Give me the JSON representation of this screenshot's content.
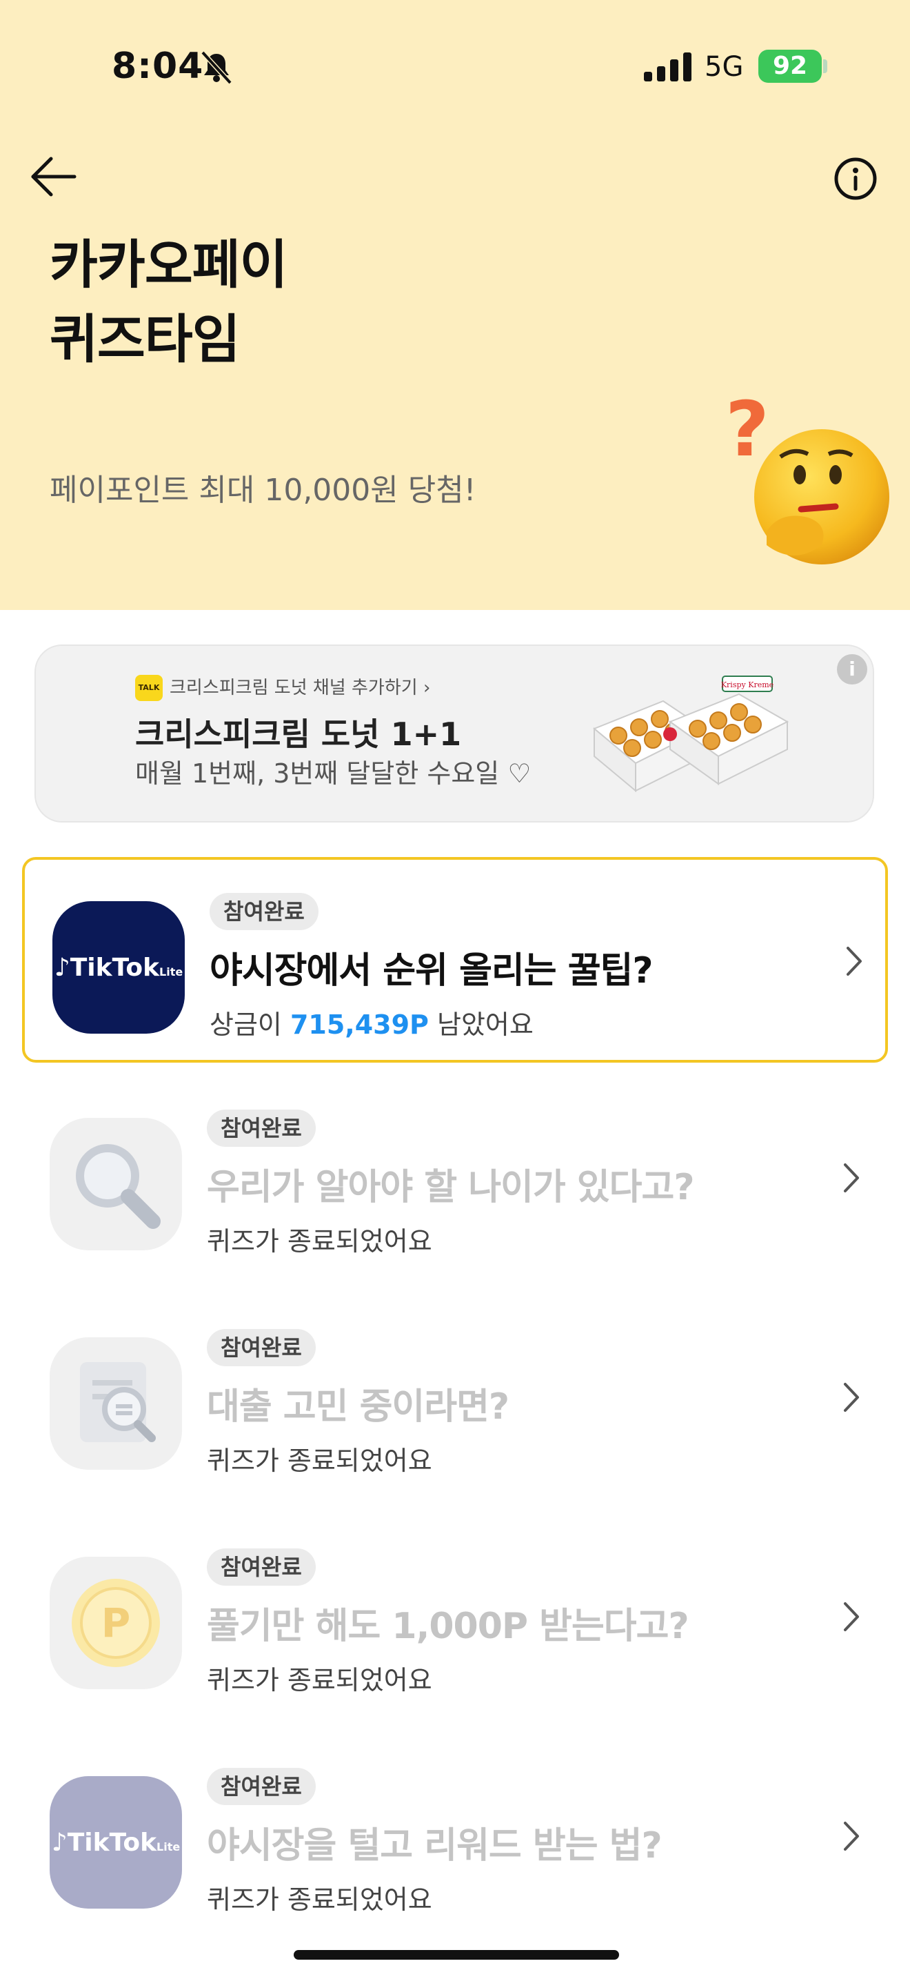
{
  "status_bar": {
    "time": "8:04",
    "network": "5G",
    "battery": "92"
  },
  "header": {
    "title": "카카오페이\n퀴즈타임",
    "subtitle": "페이포인트 최대 10,000원 당첨!",
    "bg_color": "#FDEEC0"
  },
  "ad": {
    "talk_label": "TALK",
    "channel": "크리스피크림 도넛 채널 추가하기 ›",
    "title": "크리스피크림 도넛 1+1",
    "description": "매월 1번째, 3번째 달달한 수요일 ♡",
    "brand": "Krispy Kreme"
  },
  "quizzes": [
    {
      "badge": "참여완료",
      "title": "야시장에서 순위 올리는 꿀팁?",
      "sub_prefix": "상금이 ",
      "prize": "715,439P",
      "sub_suffix": " 남았어요",
      "icon": "tiktok-lite-icon",
      "icon_label": "TikTok",
      "icon_small": "Lite"
    },
    {
      "badge": "참여완료",
      "title": "우리가 알아야 할 나이가 있다고?",
      "status": "퀴즈가 종료되었어요",
      "icon": "magnifier-icon"
    },
    {
      "badge": "참여완료",
      "title": "대출 고민 중이라면?",
      "status": "퀴즈가 종료되었어요",
      "icon": "document-search-icon"
    },
    {
      "badge": "참여완료",
      "title": "풀기만 해도 1,000P 받는다고?",
      "status": "퀴즈가 종료되었어요",
      "icon": "point-coin-icon",
      "icon_label": "P"
    },
    {
      "badge": "참여완료",
      "title": "야시장을 털고 리워드 받는 법?",
      "status": "퀴즈가 종료되었어요",
      "icon": "tiktok-lite-icon",
      "icon_label": "TikTok",
      "icon_small": "Lite"
    }
  ],
  "colors": {
    "accent_border": "#F3C623",
    "prize_blue": "#1E90F0"
  }
}
